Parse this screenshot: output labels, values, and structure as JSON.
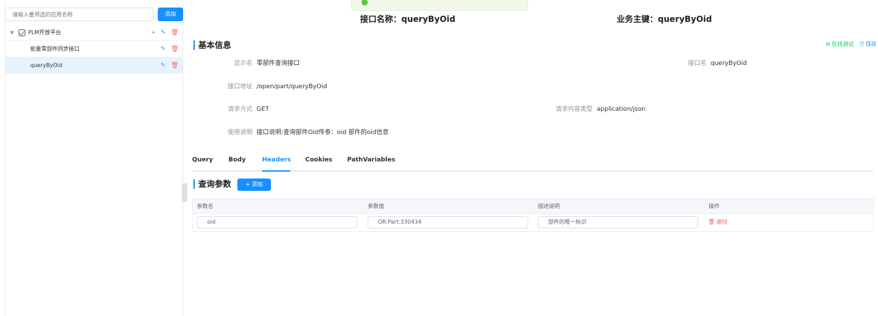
{
  "sidebar": {
    "search_placeholder": "请输入要筛选的应用名称",
    "add_label": "添加",
    "tree": {
      "root_label": "PLM开放平台",
      "children": [
        {
          "label": "批量零部件同步接口"
        },
        {
          "label": "queryByOid"
        }
      ]
    }
  },
  "header": {
    "interface_name": "接口名称：queryByOid",
    "business_key": "业务主键：queryByOid"
  },
  "basic_info": {
    "title": "基本信息",
    "online_debug_label": "在线调试",
    "save_label": "保存",
    "display_name_key": "显示名",
    "display_name_value": "零部件查询接口",
    "interface_key": "接口名",
    "interface_value": "queryByOid",
    "address_key": "接口地址",
    "address_value": "/open/part/queryByOid",
    "method_key": "请求方式",
    "method_value": "GET",
    "content_type_key": "请求内容类型",
    "content_type_value": "application/json",
    "usage_key": "使用说明",
    "usage_value": "接口说明:查询部件Oid传参：oid 部件的oid信息"
  },
  "tabs": [
    "Query",
    "Body",
    "Headers",
    "Cookies",
    "PathVariables"
  ],
  "active_tab": "Headers",
  "params": {
    "title": "查询参数",
    "add_label": "+ 添加",
    "columns": [
      "参数名",
      "参数值",
      "描述说明",
      "操作"
    ],
    "rows": [
      {
        "name": "oid",
        "value": "OR:Part:330434",
        "desc": "部件的唯一标识",
        "action": "删除"
      }
    ]
  },
  "colors": {
    "accent": "#1890ff",
    "danger": "#f56c6c",
    "success": "#13ce66"
  }
}
